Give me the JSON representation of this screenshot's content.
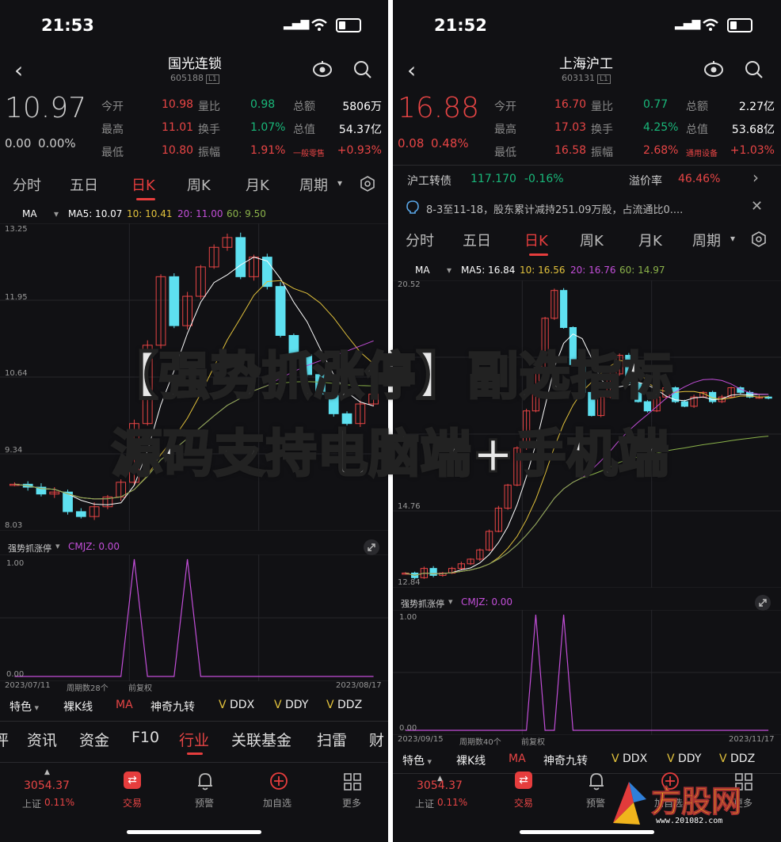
{
  "overlay": {
    "line1": "【强势抓涨停】副选指标",
    "line2": "源码支持电脑端+手机端"
  },
  "logo": {
    "text": "方股网",
    "url": "www.201082.com"
  },
  "colors": {
    "up": "#e84545",
    "down": "#19b87a",
    "accent": "#e63d3d",
    "purple": "#c24ed8",
    "ma10": "#e2c23c",
    "ma20": "#c24ed8",
    "ma60": "#8bb24a"
  },
  "left": {
    "status_time": "21:53",
    "stock_name": "国光连锁",
    "stock_code": "605188",
    "board_tag": "L1",
    "price": "10.97",
    "change": "0.00",
    "change_pct": "0.00%",
    "quote": [
      {
        "l1": "今开",
        "v1": "10.98",
        "l2": "量比",
        "v2": "0.98",
        "l3": "总额",
        "v3": "5806万"
      },
      {
        "l1": "最高",
        "v1": "11.01",
        "l2": "换手",
        "v2": "1.07%",
        "l3": "总值",
        "v3": "54.37亿"
      },
      {
        "l1": "最低",
        "v1": "10.80",
        "l2": "振幅",
        "v2": "1.91%",
        "l3": "一般零售",
        "v3": "+0.93%"
      }
    ],
    "period_tabs": [
      "分时",
      "五日",
      "日K",
      "周K",
      "月K",
      "周期"
    ],
    "active_tab": "日K",
    "ma_label": "MA",
    "ma5": "MA5: 10.07",
    "ma10": "10: 10.41",
    "ma20": "20: 11.00",
    "ma60": "60: 9.50",
    "y_axis": [
      "13.25",
      "11.95",
      "10.64",
      "9.34",
      "8.03"
    ],
    "indicator_name": "强势抓涨停",
    "indicator_value": "CMJZ: 0.00",
    "ind_axis": [
      "1.00",
      "0.00"
    ],
    "date_start": "2023/07/11",
    "period_count": "周期数28个",
    "adjust": "前复权",
    "date_end": "2023/08/17",
    "toolbar": [
      "特色",
      "裸K线",
      "MA",
      "神奇九转",
      "DDX",
      "DDY",
      "DDZ"
    ],
    "nav": [
      "评",
      "资讯",
      "资金",
      "F10",
      "行业",
      "关联基金",
      "扫雷",
      "财"
    ],
    "active_nav": "行业",
    "index_value": "3054.37",
    "index_name": "上证",
    "index_pct": "0.11%",
    "bottom": [
      "交易",
      "预警",
      "加自选",
      "更多"
    ]
  },
  "right": {
    "status_time": "21:52",
    "stock_name": "上海沪工",
    "stock_code": "603131",
    "board_tag": "L1",
    "price": "16.88",
    "change": "0.08",
    "change_pct": "0.48%",
    "quote": [
      {
        "l1": "今开",
        "v1": "16.70",
        "l2": "量比",
        "v2": "0.77",
        "l3": "总额",
        "v3": "2.27亿"
      },
      {
        "l1": "最高",
        "v1": "17.03",
        "l2": "换手",
        "v2": "4.25%",
        "l3": "总值",
        "v3": "53.68亿"
      },
      {
        "l1": "最低",
        "v1": "16.58",
        "l2": "振幅",
        "v2": "2.68%",
        "l3": "通用设备",
        "v3": "+1.03%"
      }
    ],
    "bond_name": "沪工转债",
    "bond_price": "117.170",
    "bond_pct": "-0.16%",
    "premium_label": "溢价率",
    "premium_value": "46.46%",
    "notice": "8-3至11-18，股东累计减持251.09万股，占流通比0....",
    "period_tabs": [
      "分时",
      "五日",
      "日K",
      "周K",
      "月K",
      "周期"
    ],
    "active_tab": "日K",
    "ma_label": "MA",
    "ma5": "MA5: 16.84",
    "ma10": "10: 16.56",
    "ma20": "20: 16.76",
    "ma60": "60: 14.97",
    "y_axis": [
      "20.52",
      "14.76",
      "12.84"
    ],
    "indicator_name": "强势抓涨停",
    "indicator_value": "CMJZ: 0.00",
    "ind_axis": [
      "1.00",
      "0.00"
    ],
    "date_start": "2023/09/15",
    "period_count": "周期数40个",
    "adjust": "前复权",
    "date_end": "2023/11/17",
    "toolbar": [
      "特色",
      "裸K线",
      "MA",
      "神奇九转",
      "DDX",
      "DDY",
      "DDZ"
    ],
    "index_value": "3054.37",
    "index_name": "上证",
    "index_pct": "0.11%",
    "bottom": [
      "交易",
      "预警",
      "加自选",
      "更多"
    ]
  }
}
